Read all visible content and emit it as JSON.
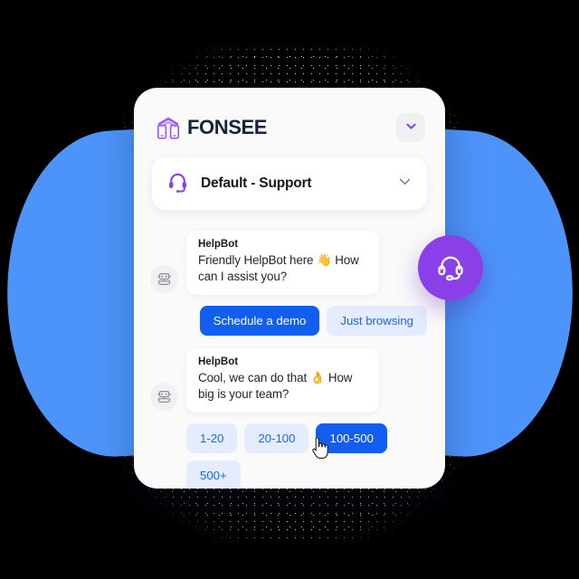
{
  "brand": {
    "name": "FONSEE",
    "logo_icon": "fonsee-arch-phones-icon",
    "accent_purple": "#8b3fe8",
    "text_color": "#16233d"
  },
  "header": {
    "collapse_icon": "chevron-down-icon"
  },
  "channel_selector": {
    "icon": "headset-icon",
    "label": "Default - Support",
    "chevron_icon": "chevron-down-icon"
  },
  "conversation": {
    "messages": [
      {
        "author": "HelpBot",
        "avatar_icon": "robot-icon",
        "text": "Friendly HelpBot here 👋  How can I assist you?",
        "replies": [
          {
            "label": "Schedule a demo",
            "style": "primary"
          },
          {
            "label": "Just browsing",
            "style": "secondary"
          }
        ]
      },
      {
        "author": "HelpBot",
        "avatar_icon": "robot-icon",
        "text": "Cool, we can do that 👌  How big is your team?",
        "replies": [
          {
            "label": "1-20",
            "style": "secondary"
          },
          {
            "label": "20-100",
            "style": "secondary"
          },
          {
            "label": "100-500",
            "style": "primary"
          },
          {
            "label": "500+",
            "style": "secondary"
          }
        ]
      }
    ]
  },
  "floating_button": {
    "icon": "headset-icon",
    "color": "#8b3fe8"
  },
  "background": {
    "canvas_color": "#000000",
    "blob_color": "#4d94fa",
    "dot_color": "#ffffff",
    "card_color": "#fafafb"
  },
  "cursor": {
    "type": "pointer-hand-cursor",
    "hovered_target": "100-500"
  },
  "colors": {
    "primary_blue": "#115ef0",
    "chip_blue_bg": "#e4ecfd",
    "chip_blue_text": "#1668f2"
  }
}
